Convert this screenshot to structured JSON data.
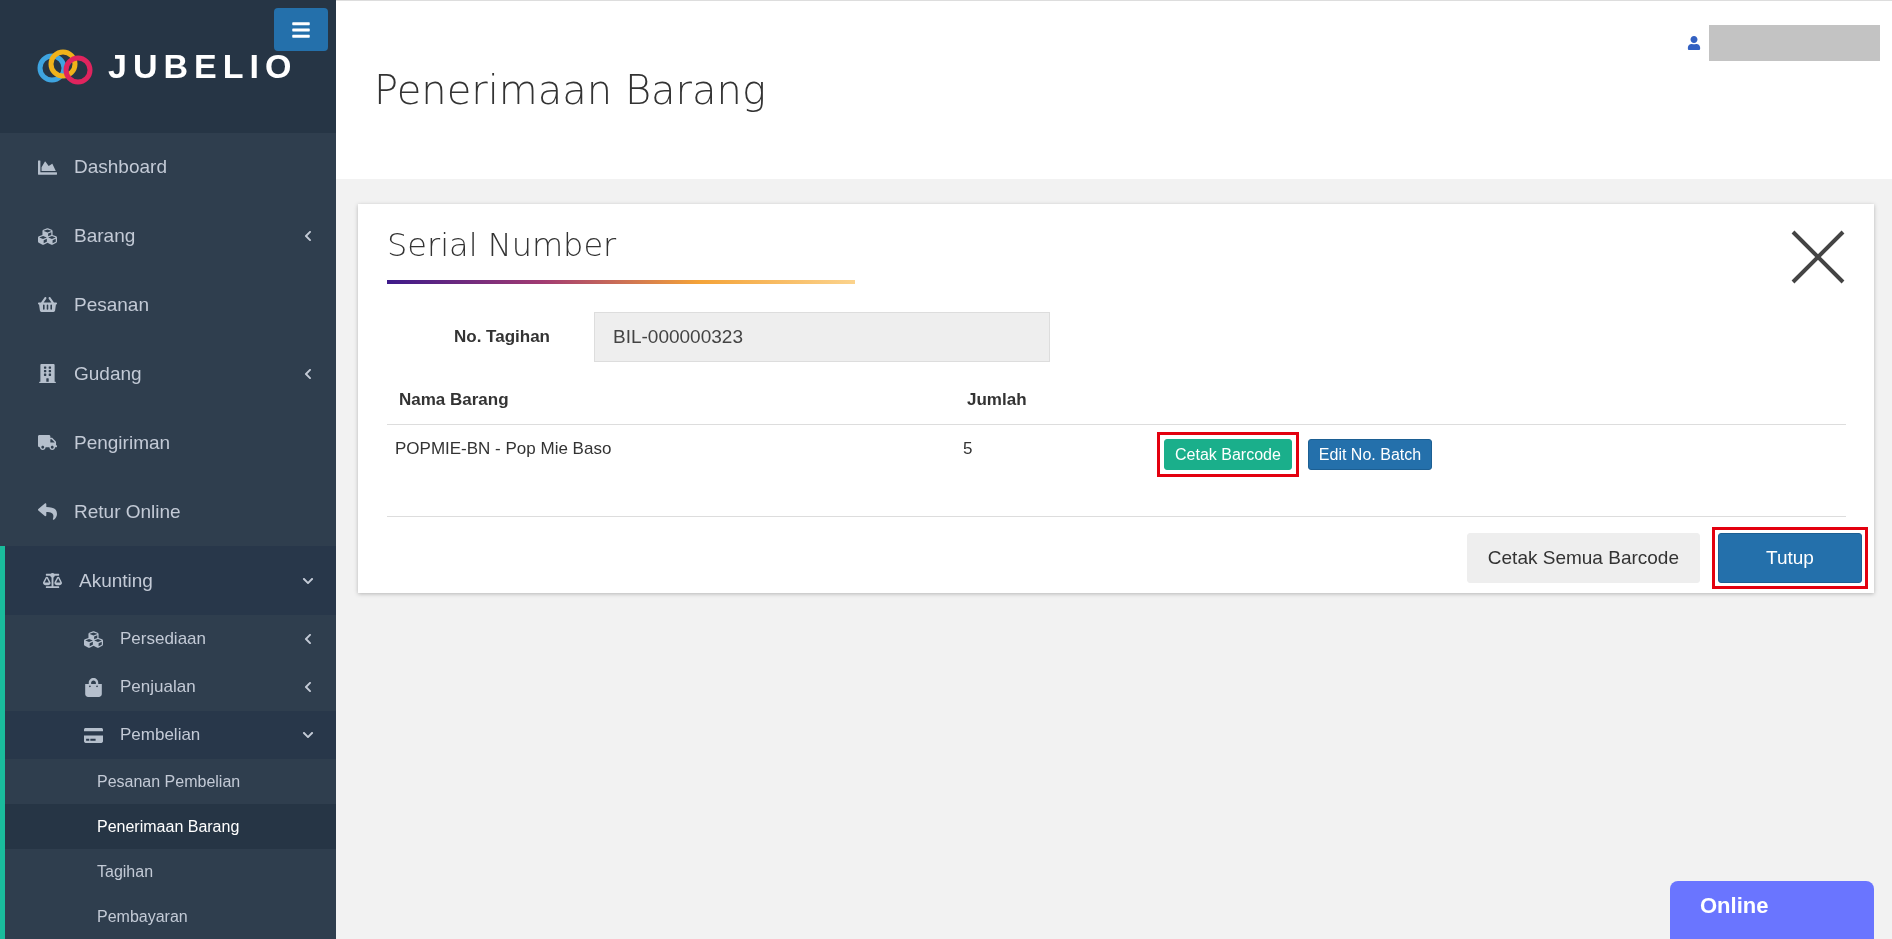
{
  "sidebar": {
    "logo": "JUBELIO",
    "items": [
      {
        "label": "Dashboard"
      },
      {
        "label": "Barang",
        "expanded": false
      },
      {
        "label": "Pesanan"
      },
      {
        "label": "Gudang",
        "expanded": false
      },
      {
        "label": "Pengiriman"
      },
      {
        "label": "Retur Online"
      },
      {
        "label": "Akunting",
        "expanded": true,
        "children": [
          {
            "label": "Persediaan",
            "expanded": false
          },
          {
            "label": "Penjualan",
            "expanded": false
          },
          {
            "label": "Pembelian",
            "expanded": true,
            "children": [
              {
                "label": "Pesanan Pembelian",
                "selected": false
              },
              {
                "label": "Penerimaan Barang",
                "selected": true
              },
              {
                "label": "Tagihan",
                "selected": false
              },
              {
                "label": "Pembayaran",
                "selected": false
              }
            ]
          }
        ]
      }
    ]
  },
  "page": {
    "title": "Penerimaan Barang"
  },
  "modal": {
    "title": "Serial Number",
    "field": {
      "label": "No. Tagihan",
      "value": "BIL-000000323"
    },
    "columns": [
      "Nama Barang",
      "Jumlah"
    ],
    "rows": [
      {
        "name": "POPMIE-BN - Pop Mie Baso",
        "qty": "5",
        "actions": [
          {
            "label": "Cetak Barcode",
            "kind": "success",
            "highlighted": true
          },
          {
            "label": "Edit No. Batch",
            "kind": "primary",
            "highlighted": false
          }
        ]
      }
    ],
    "footer_buttons": [
      {
        "label": "Cetak Semua Barcode",
        "kind": "default",
        "highlighted": false
      },
      {
        "label": "Tutup",
        "kind": "primary",
        "highlighted": true
      }
    ]
  },
  "status_badge": "Online"
}
